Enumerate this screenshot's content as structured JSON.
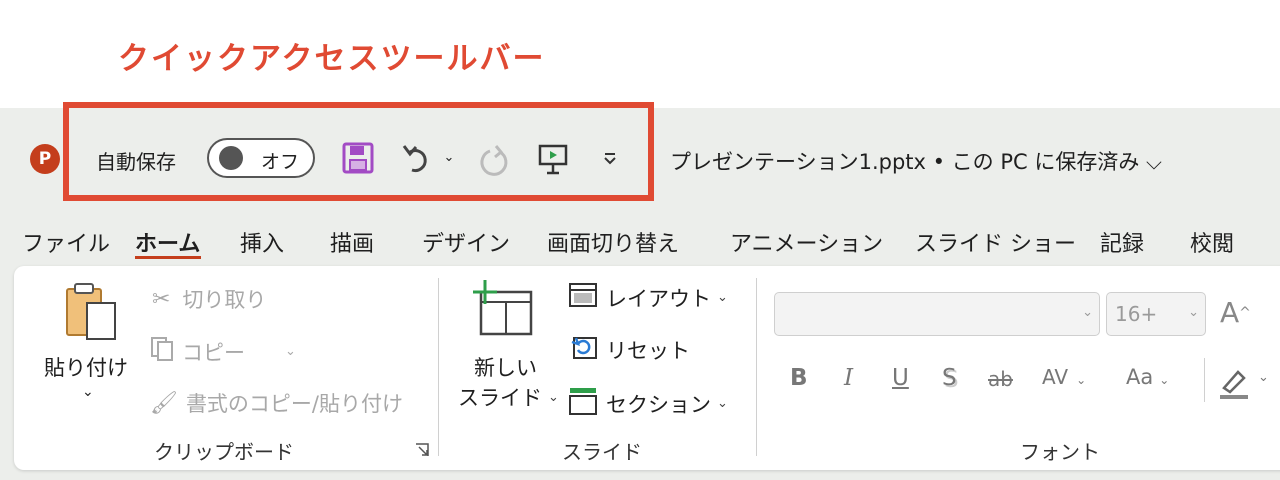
{
  "annotation": {
    "label": "クイックアクセスツールバー"
  },
  "titlebar": {
    "app_icon_letter": "P",
    "autosave_label": "自動保存",
    "autosave_state": "オフ",
    "document_title": "プレゼンテーション1.pptx • この PC に保存済み ⌵"
  },
  "tabs": [
    "ファイル",
    "ホーム",
    "挿入",
    "描画",
    "デザイン",
    "画面切り替え",
    "アニメーション",
    "スライド ショー",
    "記録",
    "校閲"
  ],
  "clipboard": {
    "paste_label": "貼り付け",
    "cut_label": "切り取り",
    "copy_label": "コピー",
    "format_painter_label": "書式のコピー/貼り付け",
    "group_label": "クリップボード"
  },
  "slides": {
    "new_slide_line1": "新しい",
    "new_slide_line2": "スライド",
    "layout_label": "レイアウト",
    "reset_label": "リセット",
    "section_label": "セクション",
    "group_label": "スライド"
  },
  "font": {
    "font_name": "",
    "font_size": "16+",
    "grow_label": "A",
    "bold": "B",
    "italic": "I",
    "underline": "U",
    "shadow": "S",
    "strike": "ab",
    "spacing": "AV",
    "case": "Aa",
    "group_label": "フォント"
  },
  "colors": {
    "accent": "#e04a33",
    "brand": "#c43e1c",
    "save_icon": "#a24bc4"
  }
}
